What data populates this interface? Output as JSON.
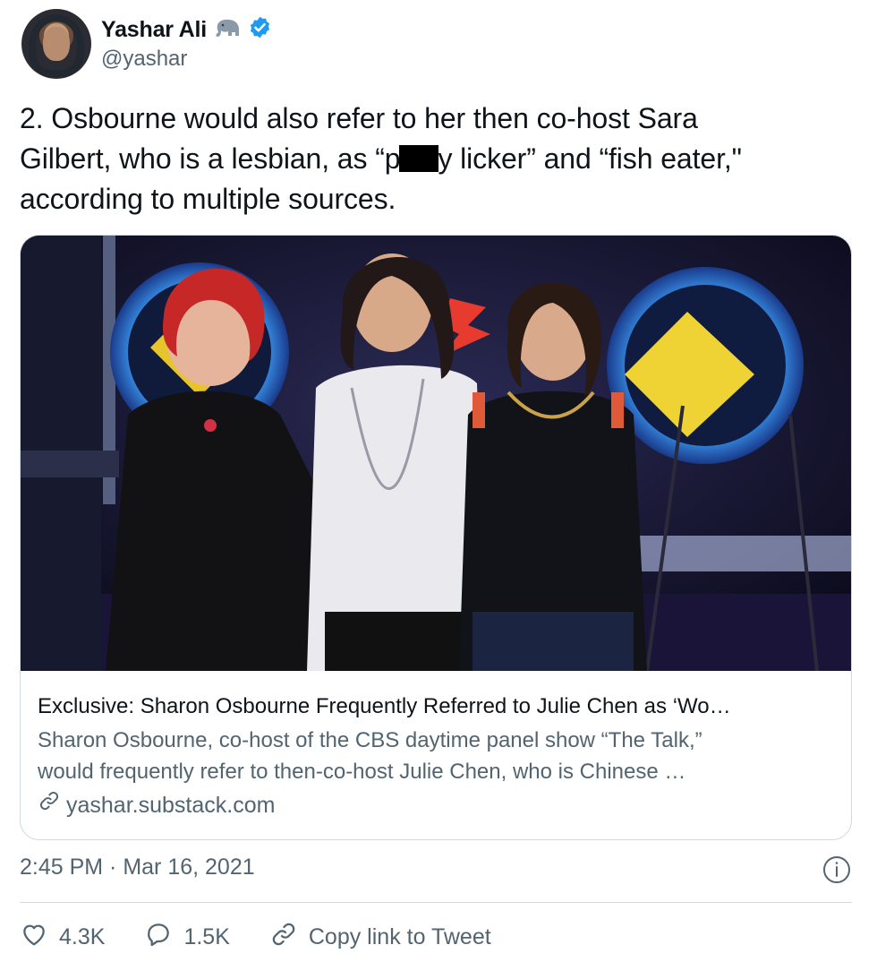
{
  "author": {
    "name": "Yashar Ali",
    "handle": "@yashar",
    "emoji_icon": "elephant-icon",
    "verified_icon": "verified-badge-icon",
    "verified_color": "#1d9bf0"
  },
  "tweet": {
    "text_lines": [
      "2. Osbourne would also refer to her then co-host Sara",
      "Gilbert, who is a lesbian, as “p",
      "y licker” and “fish eater,\"",
      "according to multiple sources."
    ]
  },
  "card": {
    "title": "Exclusive: Sharon Osbourne Frequently Referred to Julie Chen as ‘Wo…",
    "description_lines": [
      "Sharon Osbourne, co-host of the CBS daytime panel show “The Talk,”",
      "would frequently refer to then-co-host Julie Chen, who is Chinese …"
    ],
    "domain": "yashar.substack.com"
  },
  "meta": {
    "timestamp": "2:45 PM · Mar 16, 2021"
  },
  "actions": {
    "likes": "4.3K",
    "replies": "1.5K",
    "copy_link_label": "Copy link to Tweet"
  },
  "colors": {
    "text_primary": "#0f1419",
    "text_secondary": "#536471",
    "border": "#cfd9de"
  }
}
